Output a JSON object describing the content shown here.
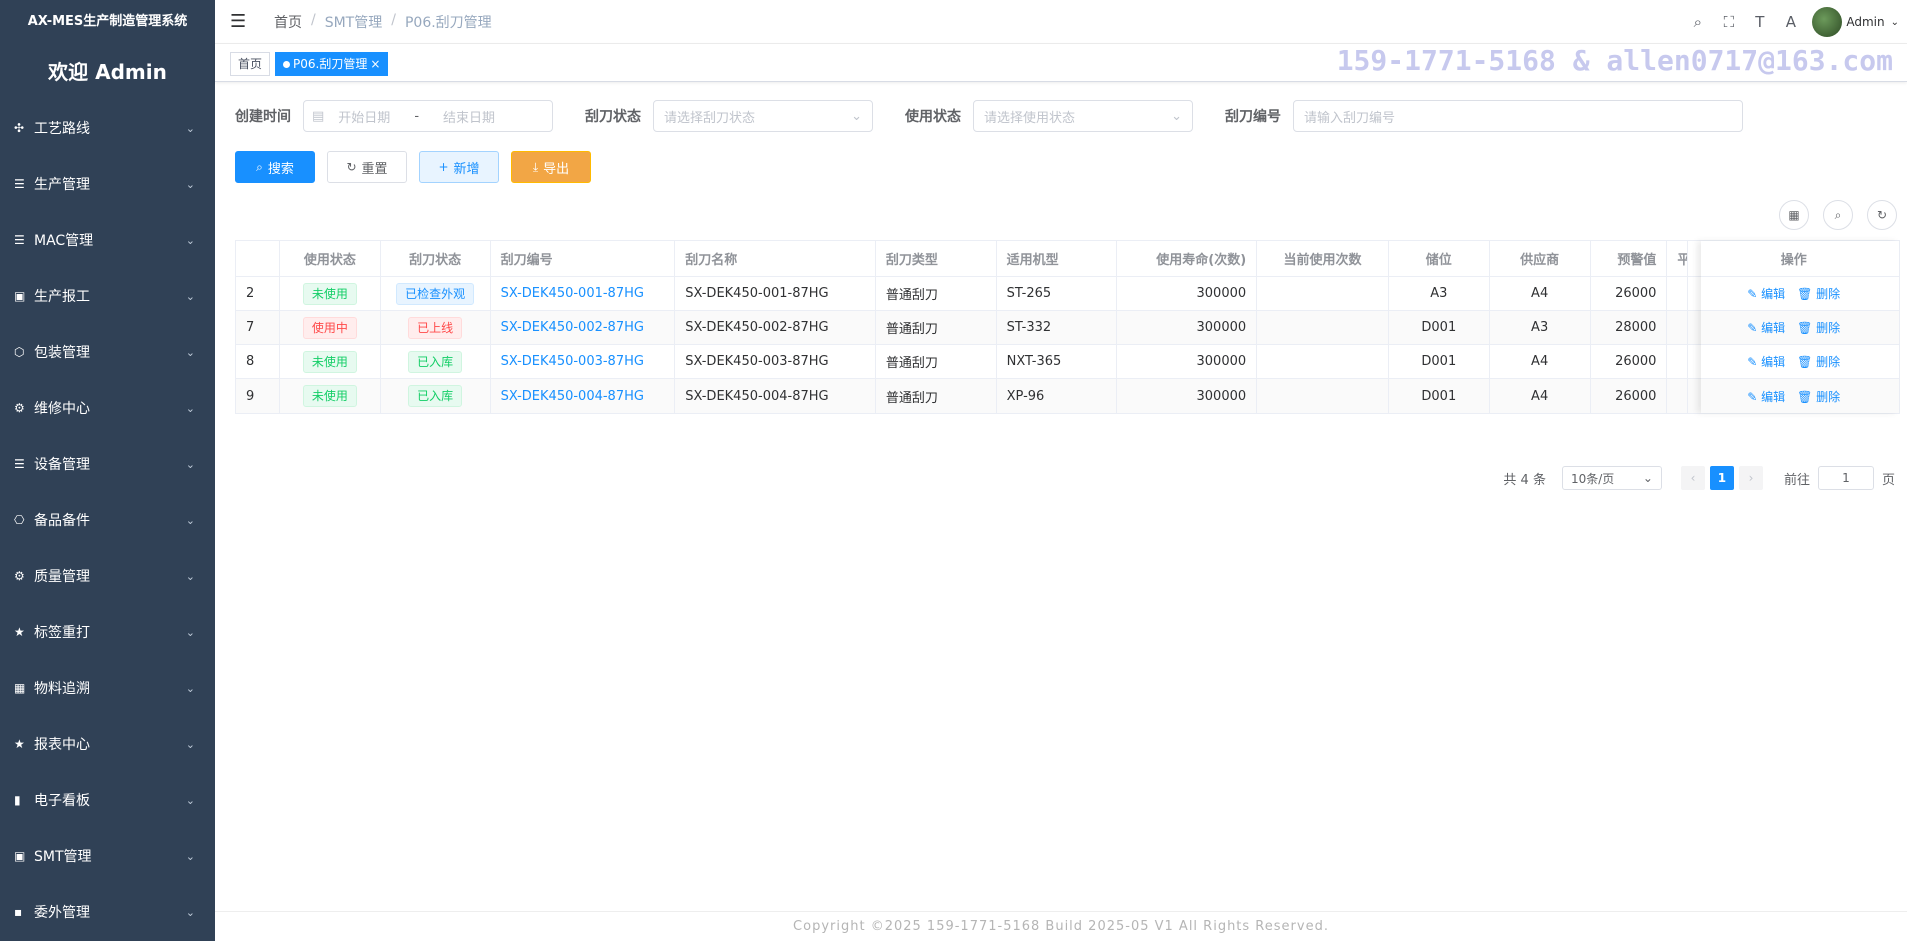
{
  "app": {
    "title": "AX-MES生产制造管理系统",
    "welcome": "欢迎 Admin"
  },
  "sidebar": {
    "items": [
      {
        "label": "工艺路线",
        "icon": "route-icon",
        "glyph": "✣"
      },
      {
        "label": "生产管理",
        "icon": "list-icon",
        "glyph": "☰"
      },
      {
        "label": "MAC管理",
        "icon": "list-icon",
        "glyph": "☰"
      },
      {
        "label": "生产报工",
        "icon": "chart-monitor-icon",
        "glyph": "▣"
      },
      {
        "label": "包装管理",
        "icon": "box-icon",
        "glyph": "⬡"
      },
      {
        "label": "维修中心",
        "icon": "grid-circles-icon",
        "glyph": "⚙"
      },
      {
        "label": "设备管理",
        "icon": "list-icon",
        "glyph": "☰"
      },
      {
        "label": "备品备件",
        "icon": "parts-icon",
        "glyph": "⎔"
      },
      {
        "label": "质量管理",
        "icon": "grid-circles-icon",
        "glyph": "⚙"
      },
      {
        "label": "标签重打",
        "icon": "star-icon",
        "glyph": "★"
      },
      {
        "label": "物料追溯",
        "icon": "table-icon",
        "glyph": "▦"
      },
      {
        "label": "报表中心",
        "icon": "star-icon",
        "glyph": "★"
      },
      {
        "label": "电子看板",
        "icon": "bar-chart-icon",
        "glyph": "▮"
      },
      {
        "label": "SMT管理",
        "icon": "monitor-icon",
        "glyph": "▣"
      },
      {
        "label": "委外管理",
        "icon": "grid-icon",
        "glyph": "▪"
      }
    ]
  },
  "navbar": {
    "breadcrumb": [
      "首页",
      "SMT管理",
      "P06.刮刀管理"
    ],
    "user": "Admin"
  },
  "tags": {
    "home": "首页",
    "active": "P06.刮刀管理"
  },
  "watermark": "159-1771-5168 & allen0717@163.com",
  "filters": {
    "create_time_label": "创建时间",
    "start_placeholder": "开始日期",
    "range_sep": "-",
    "end_placeholder": "结束日期",
    "blade_status_label": "刮刀状态",
    "blade_status_placeholder": "请选择刮刀状态",
    "use_status_label": "使用状态",
    "use_status_placeholder": "请选择使用状态",
    "blade_no_label": "刮刀编号",
    "blade_no_placeholder": "请输入刮刀编号"
  },
  "buttons": {
    "search": "搜索",
    "reset": "重置",
    "add": "新增",
    "export": "导出"
  },
  "table": {
    "columns": [
      "",
      "使用状态",
      "刮刀状态",
      "刮刀编号",
      "刮刀名称",
      "刮刀类型",
      "适用机型",
      "使用寿命(次数)",
      "当前使用次数",
      "储位",
      "供应商",
      "预警值",
      "平",
      "操作"
    ],
    "rows": [
      {
        "id": "2",
        "use": "未使用",
        "use_type": "success",
        "status": "已检查外观",
        "status_type": "info",
        "no": "SX-DEK450-001-87HG",
        "name": "SX-DEK450-001-87HG",
        "type": "普通刮刀",
        "model": "ST-265",
        "life": "300000",
        "current": "",
        "loc": "A3",
        "supplier": "A4",
        "warn": "26000"
      },
      {
        "id": "7",
        "use": "使用中",
        "use_type": "danger",
        "status": "已上线",
        "status_type": "danger",
        "no": "SX-DEK450-002-87HG",
        "name": "SX-DEK450-002-87HG",
        "type": "普通刮刀",
        "model": "ST-332",
        "life": "300000",
        "current": "",
        "loc": "D001",
        "supplier": "A3",
        "warn": "28000"
      },
      {
        "id": "8",
        "use": "未使用",
        "use_type": "success",
        "status": "已入库",
        "status_type": "success",
        "no": "SX-DEK450-003-87HG",
        "name": "SX-DEK450-003-87HG",
        "type": "普通刮刀",
        "model": "NXT-365",
        "life": "300000",
        "current": "",
        "loc": "D001",
        "supplier": "A4",
        "warn": "26000"
      },
      {
        "id": "9",
        "use": "未使用",
        "use_type": "success",
        "status": "已入库",
        "status_type": "success",
        "no": "SX-DEK450-004-87HG",
        "name": "SX-DEK450-004-87HG",
        "type": "普通刮刀",
        "model": "XP-96",
        "life": "300000",
        "current": "",
        "loc": "D001",
        "supplier": "A4",
        "warn": "26000"
      }
    ],
    "edit_label": "编辑",
    "delete_label": "删除"
  },
  "pagination": {
    "total": "共 4 条",
    "page_size": "10条/页",
    "current": "1",
    "goto_label": "前往",
    "goto_value": "1",
    "page_suffix": "页"
  },
  "footer": "Copyright ©2025 159-1771-5168 Build 2025-05 V1 All Rights Reserved.",
  "colors": {
    "sidebar": "#304156",
    "primary": "#1890ff",
    "warning": "#f2a645"
  }
}
